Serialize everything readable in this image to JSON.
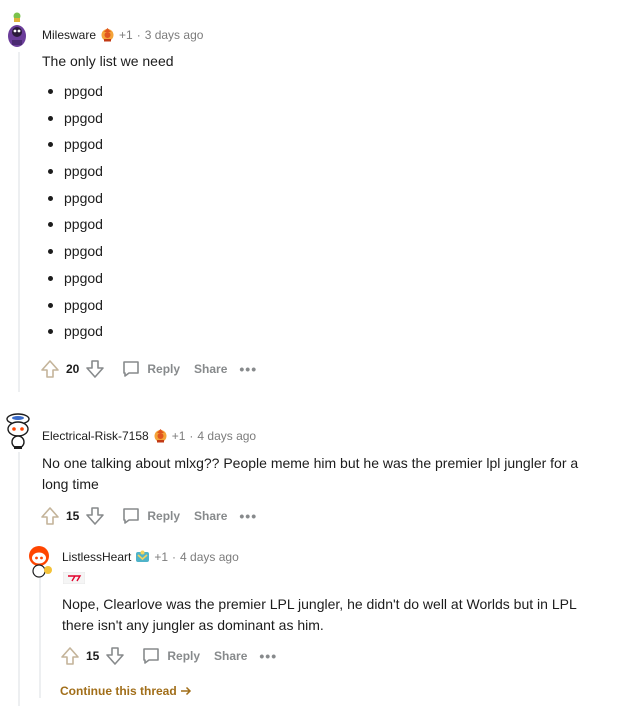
{
  "comments": [
    {
      "author": "Milesware",
      "score_delta": "+1",
      "time": "3 days ago",
      "text": "The only list we need",
      "list_items": [
        "ppgod",
        "ppgod",
        "ppgod",
        "ppgod",
        "ppgod",
        "ppgod",
        "ppgod",
        "ppgod",
        "ppgod",
        "ppgod"
      ],
      "votes": "20"
    },
    {
      "author": "Electrical-Risk-7158",
      "score_delta": "+1",
      "time": "4 days ago",
      "text": "No one talking about mlxg?? People meme him but he was the premier lpl jungler for a long time",
      "votes": "15"
    },
    {
      "author": "ListlessHeart",
      "score_delta": "+1",
      "time": "4 days ago",
      "text": "Nope, Clearlove was the premier LPL jungler, he didn't do well at Worlds but in LPL there isn't any jungler as dominant as him.",
      "votes": "15"
    }
  ],
  "actions": {
    "reply": "Reply",
    "share": "Share",
    "more": "•••"
  },
  "separator": "·",
  "continue_thread": "Continue this thread",
  "colors": {
    "meta": "#7c7c7c",
    "action": "#878a8c",
    "continue": "#a16e19",
    "thread_line": "#edeff1"
  }
}
